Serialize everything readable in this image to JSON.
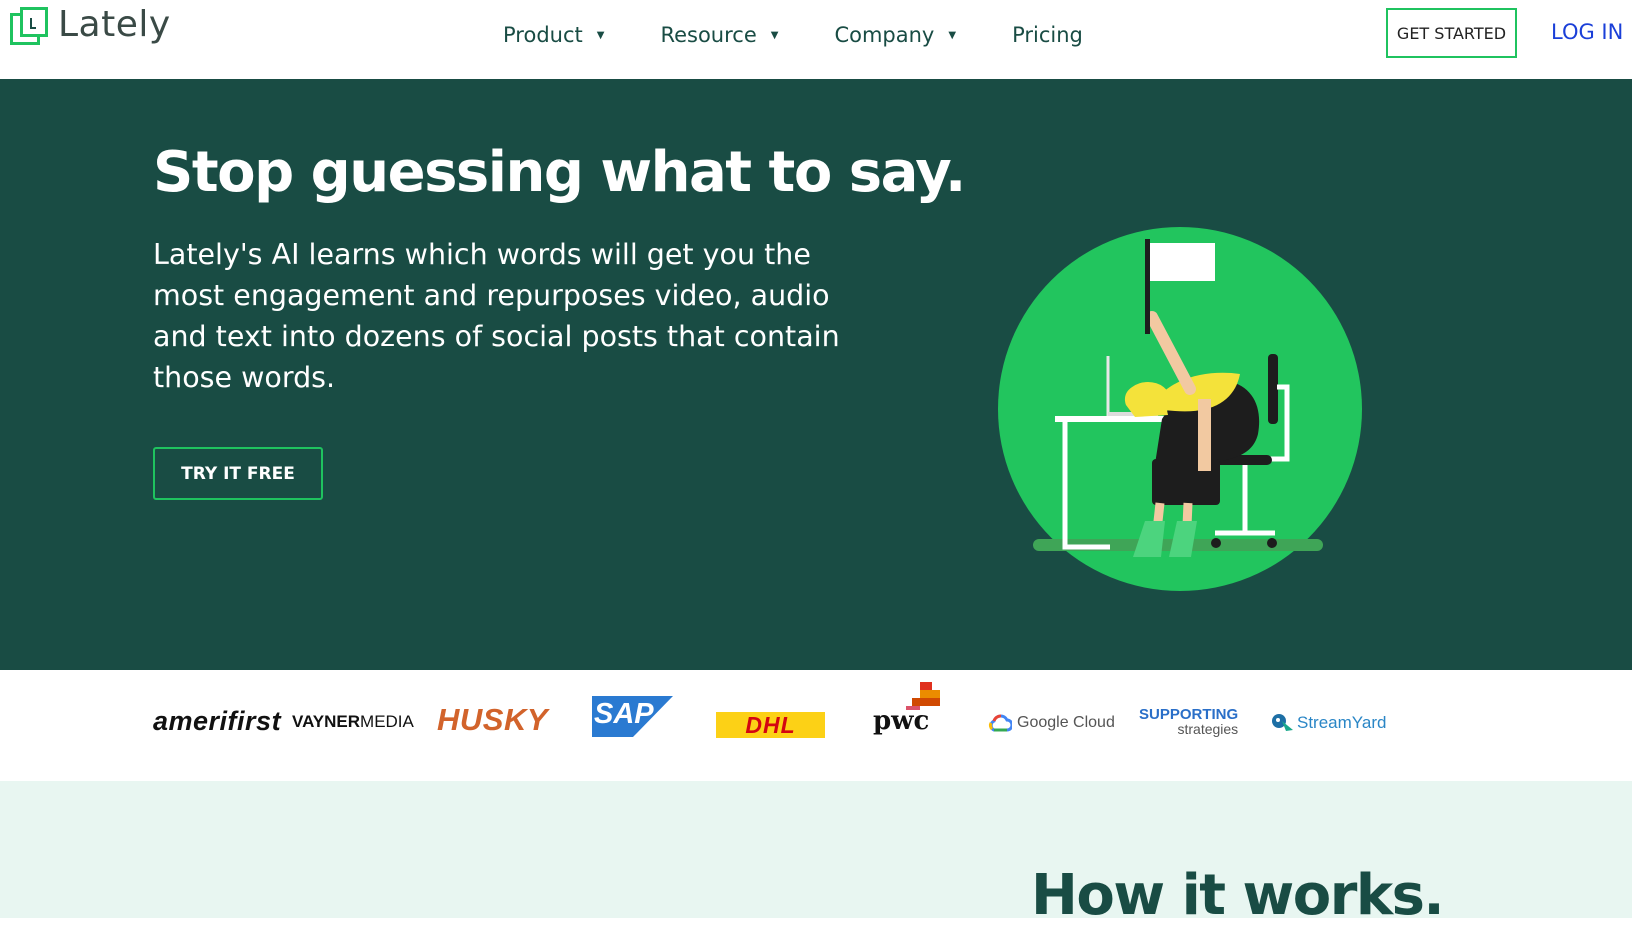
{
  "brand": {
    "name": "Lately"
  },
  "nav": {
    "items": [
      {
        "label": "Product",
        "has_caret": true
      },
      {
        "label": "Resource",
        "has_caret": true
      },
      {
        "label": "Company",
        "has_caret": true
      },
      {
        "label": "Pricing",
        "has_caret": false
      }
    ],
    "caret_glyph": "▼",
    "get_started": "GET STARTED",
    "login": "LOG IN"
  },
  "hero": {
    "title": "Stop guessing what to say.",
    "subtitle": "Lately's AI learns which words will get you the most engagement and repurposes video, audio and text into dozens of social posts that contain those words.",
    "cta": "TRY IT FREE"
  },
  "logos": {
    "amerifirst": "amerifirst",
    "vayner_a": "VAYNER",
    "vayner_b": "MEDIA",
    "husky": "HUSKY",
    "sap": "SAP",
    "dhl": "DHL",
    "pwc": "pwc",
    "google_cloud": "Google Cloud",
    "supporting_a": "SUPPORTING",
    "supporting_b": "strategies",
    "streamyard": "StreamYard"
  },
  "how": {
    "title": "How it works."
  },
  "colors": {
    "dark_green": "#194c44",
    "accent_green": "#1fc35f",
    "link_blue": "#1a3fd8",
    "light_mint": "#e8f6f1"
  }
}
